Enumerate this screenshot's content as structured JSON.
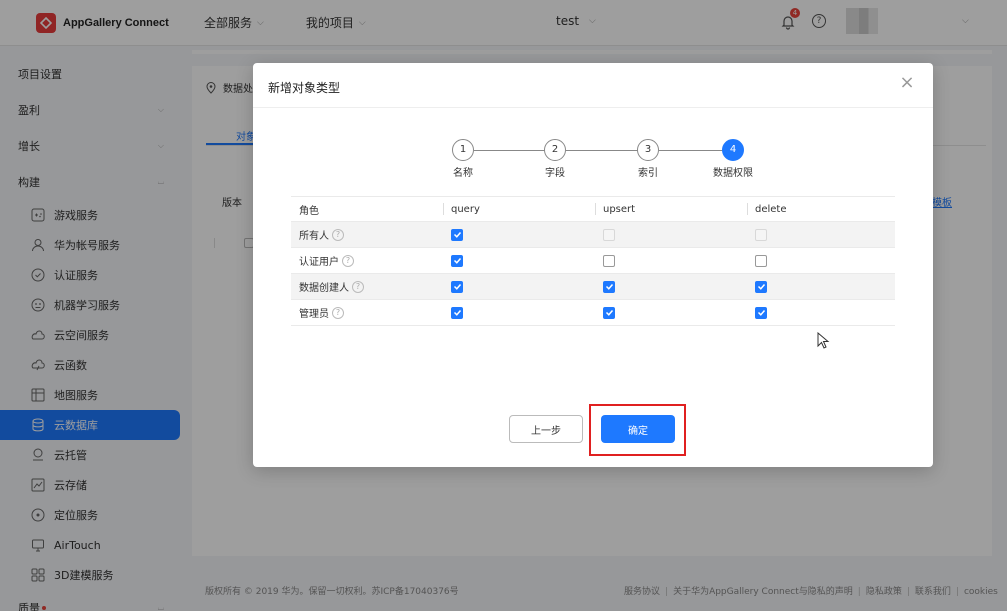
{
  "header": {
    "brand": "AppGallery Connect",
    "nav": [
      "全部服务",
      "我的项目"
    ],
    "project": "test",
    "bell_badge": "4",
    "help": "?"
  },
  "sidebar": {
    "project_settings": "项目设置",
    "monetize": "盈利",
    "grow": "增长",
    "build": "构建",
    "items": [
      {
        "label": "游戏服务",
        "icon": "gamepad-icon"
      },
      {
        "label": "华为帐号服务",
        "icon": "user-icon"
      },
      {
        "label": "认证服务",
        "icon": "shield-check-icon"
      },
      {
        "label": "机器学习服务",
        "icon": "ml-icon"
      },
      {
        "label": "云空间服务",
        "icon": "cloud-icon"
      },
      {
        "label": "云函数",
        "icon": "function-icon"
      },
      {
        "label": "地图服务",
        "icon": "map-icon"
      },
      {
        "label": "云数据库",
        "icon": "database-icon"
      },
      {
        "label": "云托管",
        "icon": "hosting-icon"
      },
      {
        "label": "云存储",
        "icon": "storage-icon"
      },
      {
        "label": "定位服务",
        "icon": "location-icon"
      },
      {
        "label": "AirTouch",
        "icon": "airtouch-icon"
      },
      {
        "label": "3D建模服务",
        "icon": "modeling-icon"
      }
    ],
    "active_index": 7,
    "quality": "质量"
  },
  "background": {
    "location_label": "数据处",
    "tab_label": "对象",
    "version_label": "版本",
    "link_label": "模板"
  },
  "modal": {
    "title": "新增对象类型",
    "close": "×",
    "steps": [
      {
        "num": "1",
        "label": "名称"
      },
      {
        "num": "2",
        "label": "字段"
      },
      {
        "num": "3",
        "label": "索引"
      },
      {
        "num": "4",
        "label": "数据权限"
      }
    ],
    "current_step": 4,
    "columns": [
      "角色",
      "query",
      "upsert",
      "delete"
    ],
    "rows": [
      {
        "role": "所有人",
        "query": "checked",
        "upsert": "disabled",
        "delete": "disabled"
      },
      {
        "role": "认证用户",
        "query": "checked",
        "upsert": "unchecked",
        "delete": "unchecked"
      },
      {
        "role": "数据创建人",
        "query": "checked",
        "upsert": "checked",
        "delete": "checked"
      },
      {
        "role": "管理员",
        "query": "checked",
        "upsert": "checked",
        "delete": "checked"
      }
    ],
    "prev_label": "上一步",
    "ok_label": "确定"
  },
  "footer": {
    "copyright": "版权所有 © 2019 华为。保留一切权利。苏ICP备17040376号",
    "links": [
      "服务协议",
      "关于华为AppGallery Connect与隐私的声明",
      "隐私政策",
      "联系我们",
      "cookies"
    ]
  },
  "colors": {
    "accent": "#1e79ff",
    "highlight": "#e02020",
    "badge": "#e8453c"
  }
}
